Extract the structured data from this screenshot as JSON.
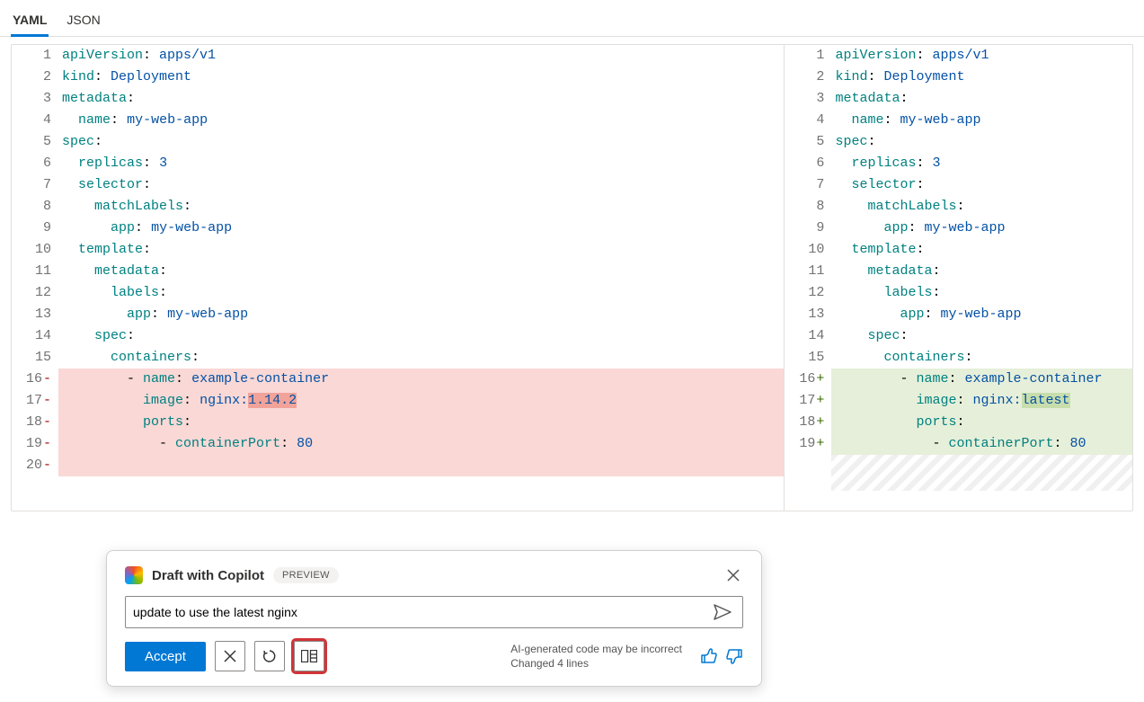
{
  "tabs": {
    "yaml": "YAML",
    "json": "JSON",
    "active": "yaml"
  },
  "left": {
    "lines": [
      {
        "n": "1",
        "s": "",
        "tokens": [
          {
            "t": "apiVersion",
            "c": "tok-key"
          },
          {
            "t": ":",
            "c": "tok-punc"
          },
          {
            "t": " "
          },
          {
            "t": "apps/v1",
            "c": "tok-val"
          }
        ]
      },
      {
        "n": "2",
        "s": "",
        "tokens": [
          {
            "t": "kind",
            "c": "tok-key"
          },
          {
            "t": ":",
            "c": "tok-punc"
          },
          {
            "t": " "
          },
          {
            "t": "Deployment",
            "c": "tok-val"
          }
        ]
      },
      {
        "n": "3",
        "s": "",
        "tokens": [
          {
            "t": "metadata",
            "c": "tok-key"
          },
          {
            "t": ":",
            "c": "tok-punc"
          }
        ]
      },
      {
        "n": "4",
        "s": "",
        "tokens": [
          {
            "t": "  "
          },
          {
            "t": "name",
            "c": "tok-key"
          },
          {
            "t": ":",
            "c": "tok-punc"
          },
          {
            "t": " "
          },
          {
            "t": "my-web-app",
            "c": "tok-val"
          }
        ]
      },
      {
        "n": "5",
        "s": "",
        "tokens": [
          {
            "t": "spec",
            "c": "tok-key"
          },
          {
            "t": ":",
            "c": "tok-punc"
          }
        ]
      },
      {
        "n": "6",
        "s": "",
        "tokens": [
          {
            "t": "  "
          },
          {
            "t": "replicas",
            "c": "tok-key"
          },
          {
            "t": ":",
            "c": "tok-punc"
          },
          {
            "t": " "
          },
          {
            "t": "3",
            "c": "tok-val"
          }
        ]
      },
      {
        "n": "7",
        "s": "",
        "tokens": [
          {
            "t": "  "
          },
          {
            "t": "selector",
            "c": "tok-key"
          },
          {
            "t": ":",
            "c": "tok-punc"
          }
        ]
      },
      {
        "n": "8",
        "s": "",
        "tokens": [
          {
            "t": "    "
          },
          {
            "t": "matchLabels",
            "c": "tok-key"
          },
          {
            "t": ":",
            "c": "tok-punc"
          }
        ]
      },
      {
        "n": "9",
        "s": "",
        "tokens": [
          {
            "t": "      "
          },
          {
            "t": "app",
            "c": "tok-key"
          },
          {
            "t": ":",
            "c": "tok-punc"
          },
          {
            "t": " "
          },
          {
            "t": "my-web-app",
            "c": "tok-val"
          }
        ]
      },
      {
        "n": "10",
        "s": "",
        "tokens": [
          {
            "t": "  "
          },
          {
            "t": "template",
            "c": "tok-key"
          },
          {
            "t": ":",
            "c": "tok-punc"
          }
        ]
      },
      {
        "n": "11",
        "s": "",
        "tokens": [
          {
            "t": "    "
          },
          {
            "t": "metadata",
            "c": "tok-key"
          },
          {
            "t": ":",
            "c": "tok-punc"
          }
        ]
      },
      {
        "n": "12",
        "s": "",
        "tokens": [
          {
            "t": "      "
          },
          {
            "t": "labels",
            "c": "tok-key"
          },
          {
            "t": ":",
            "c": "tok-punc"
          }
        ]
      },
      {
        "n": "13",
        "s": "",
        "tokens": [
          {
            "t": "        "
          },
          {
            "t": "app",
            "c": "tok-key"
          },
          {
            "t": ":",
            "c": "tok-punc"
          },
          {
            "t": " "
          },
          {
            "t": "my-web-app",
            "c": "tok-val"
          }
        ]
      },
      {
        "n": "14",
        "s": "",
        "tokens": [
          {
            "t": "    "
          },
          {
            "t": "spec",
            "c": "tok-key"
          },
          {
            "t": ":",
            "c": "tok-punc"
          }
        ]
      },
      {
        "n": "15",
        "s": "",
        "tokens": [
          {
            "t": "      "
          },
          {
            "t": "containers",
            "c": "tok-key"
          },
          {
            "t": ":",
            "c": "tok-punc"
          }
        ]
      },
      {
        "n": "16",
        "s": "del",
        "marker": "-",
        "tokens": [
          {
            "t": "        "
          },
          {
            "t": "- ",
            "c": "tok-dash"
          },
          {
            "t": "name",
            "c": "tok-key"
          },
          {
            "t": ":",
            "c": "tok-punc"
          },
          {
            "t": " "
          },
          {
            "t": "example-container",
            "c": "tok-val"
          }
        ]
      },
      {
        "n": "17",
        "s": "del",
        "marker": "-",
        "tokens": [
          {
            "t": "          "
          },
          {
            "t": "image",
            "c": "tok-key"
          },
          {
            "t": ":",
            "c": "tok-punc"
          },
          {
            "t": " "
          },
          {
            "t": "nginx:",
            "c": "tok-val"
          },
          {
            "t": "1.14.2",
            "c": "tok-val inner-del"
          }
        ]
      },
      {
        "n": "18",
        "s": "del",
        "marker": "-",
        "tokens": [
          {
            "t": "          "
          },
          {
            "t": "ports",
            "c": "tok-key"
          },
          {
            "t": ":",
            "c": "tok-punc"
          }
        ]
      },
      {
        "n": "19",
        "s": "del",
        "marker": "-",
        "tokens": [
          {
            "t": "            "
          },
          {
            "t": "- ",
            "c": "tok-dash"
          },
          {
            "t": "containerPort",
            "c": "tok-key"
          },
          {
            "t": ":",
            "c": "tok-punc"
          },
          {
            "t": " "
          },
          {
            "t": "80",
            "c": "tok-val"
          }
        ]
      },
      {
        "n": "20",
        "s": "del",
        "marker": "-",
        "tokens": []
      }
    ]
  },
  "right": {
    "lines": [
      {
        "n": "1",
        "s": "",
        "tokens": [
          {
            "t": "apiVersion",
            "c": "tok-key"
          },
          {
            "t": ":",
            "c": "tok-punc"
          },
          {
            "t": " "
          },
          {
            "t": "apps/v1",
            "c": "tok-val"
          }
        ]
      },
      {
        "n": "2",
        "s": "",
        "tokens": [
          {
            "t": "kind",
            "c": "tok-key"
          },
          {
            "t": ":",
            "c": "tok-punc"
          },
          {
            "t": " "
          },
          {
            "t": "Deployment",
            "c": "tok-val"
          }
        ]
      },
      {
        "n": "3",
        "s": "",
        "tokens": [
          {
            "t": "metadata",
            "c": "tok-key"
          },
          {
            "t": ":",
            "c": "tok-punc"
          }
        ]
      },
      {
        "n": "4",
        "s": "",
        "tokens": [
          {
            "t": "  "
          },
          {
            "t": "name",
            "c": "tok-key"
          },
          {
            "t": ":",
            "c": "tok-punc"
          },
          {
            "t": " "
          },
          {
            "t": "my-web-app",
            "c": "tok-val"
          }
        ]
      },
      {
        "n": "5",
        "s": "",
        "tokens": [
          {
            "t": "spec",
            "c": "tok-key"
          },
          {
            "t": ":",
            "c": "tok-punc"
          }
        ]
      },
      {
        "n": "6",
        "s": "",
        "tokens": [
          {
            "t": "  "
          },
          {
            "t": "replicas",
            "c": "tok-key"
          },
          {
            "t": ":",
            "c": "tok-punc"
          },
          {
            "t": " "
          },
          {
            "t": "3",
            "c": "tok-val"
          }
        ]
      },
      {
        "n": "7",
        "s": "",
        "tokens": [
          {
            "t": "  "
          },
          {
            "t": "selector",
            "c": "tok-key"
          },
          {
            "t": ":",
            "c": "tok-punc"
          }
        ]
      },
      {
        "n": "8",
        "s": "",
        "tokens": [
          {
            "t": "    "
          },
          {
            "t": "matchLabels",
            "c": "tok-key"
          },
          {
            "t": ":",
            "c": "tok-punc"
          }
        ]
      },
      {
        "n": "9",
        "s": "",
        "tokens": [
          {
            "t": "      "
          },
          {
            "t": "app",
            "c": "tok-key"
          },
          {
            "t": ":",
            "c": "tok-punc"
          },
          {
            "t": " "
          },
          {
            "t": "my-web-app",
            "c": "tok-val"
          }
        ]
      },
      {
        "n": "10",
        "s": "",
        "tokens": [
          {
            "t": "  "
          },
          {
            "t": "template",
            "c": "tok-key"
          },
          {
            "t": ":",
            "c": "tok-punc"
          }
        ]
      },
      {
        "n": "11",
        "s": "",
        "tokens": [
          {
            "t": "    "
          },
          {
            "t": "metadata",
            "c": "tok-key"
          },
          {
            "t": ":",
            "c": "tok-punc"
          }
        ]
      },
      {
        "n": "12",
        "s": "",
        "tokens": [
          {
            "t": "      "
          },
          {
            "t": "labels",
            "c": "tok-key"
          },
          {
            "t": ":",
            "c": "tok-punc"
          }
        ]
      },
      {
        "n": "13",
        "s": "",
        "tokens": [
          {
            "t": "        "
          },
          {
            "t": "app",
            "c": "tok-key"
          },
          {
            "t": ":",
            "c": "tok-punc"
          },
          {
            "t": " "
          },
          {
            "t": "my-web-app",
            "c": "tok-val"
          }
        ]
      },
      {
        "n": "14",
        "s": "",
        "tokens": [
          {
            "t": "    "
          },
          {
            "t": "spec",
            "c": "tok-key"
          },
          {
            "t": ":",
            "c": "tok-punc"
          }
        ]
      },
      {
        "n": "15",
        "s": "",
        "tokens": [
          {
            "t": "      "
          },
          {
            "t": "containers",
            "c": "tok-key"
          },
          {
            "t": ":",
            "c": "tok-punc"
          }
        ]
      },
      {
        "n": "16",
        "s": "add",
        "marker": "+",
        "tokens": [
          {
            "t": "        "
          },
          {
            "t": "- ",
            "c": "tok-dash"
          },
          {
            "t": "name",
            "c": "tok-key"
          },
          {
            "t": ":",
            "c": "tok-punc"
          },
          {
            "t": " "
          },
          {
            "t": "example-container",
            "c": "tok-val"
          }
        ]
      },
      {
        "n": "17",
        "s": "add",
        "marker": "+",
        "tokens": [
          {
            "t": "          "
          },
          {
            "t": "image",
            "c": "tok-key"
          },
          {
            "t": ":",
            "c": "tok-punc"
          },
          {
            "t": " "
          },
          {
            "t": "nginx:",
            "c": "tok-val"
          },
          {
            "t": "latest",
            "c": "tok-val inner-add"
          }
        ]
      },
      {
        "n": "18",
        "s": "add",
        "marker": "+",
        "tokens": [
          {
            "t": "          "
          },
          {
            "t": "ports",
            "c": "tok-key"
          },
          {
            "t": ":",
            "c": "tok-punc"
          }
        ]
      },
      {
        "n": "19",
        "s": "add",
        "marker": "+",
        "tokens": [
          {
            "t": "            "
          },
          {
            "t": "- ",
            "c": "tok-dash"
          },
          {
            "t": "containerPort",
            "c": "tok-key"
          },
          {
            "t": ":",
            "c": "tok-punc"
          },
          {
            "t": " "
          },
          {
            "t": "80",
            "c": "tok-val"
          }
        ]
      }
    ],
    "hatched_after": true
  },
  "copilot": {
    "title": "Draft with Copilot",
    "badge": "PREVIEW",
    "input_value": "update to use the latest nginx",
    "accept": "Accept",
    "info_line1": "AI-generated code may be incorrect",
    "info_line2": "Changed 4 lines"
  }
}
